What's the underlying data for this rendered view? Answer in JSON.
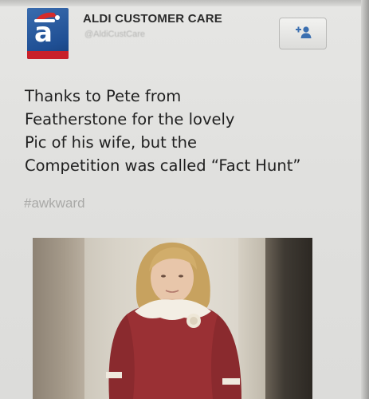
{
  "account": {
    "name": "ALDI CUSTOMER CARE",
    "handle": "@AldiCustCare",
    "avatar_letter": "a",
    "avatar_color": "#2a5da3"
  },
  "follow_button": {
    "icon": "add-user-icon"
  },
  "tweet": {
    "lines": [
      "Thanks to Pete from",
      "Featherstone for the lovely",
      "Pic of his wife, but the",
      "Competition was called “Fact Hunt”"
    ],
    "hashtag": "#awkward"
  },
  "colors": {
    "text": "#1f1f1f",
    "muted": "#a9a9a7",
    "brand_blue": "#2a5da3",
    "brand_red": "#c8202a"
  }
}
